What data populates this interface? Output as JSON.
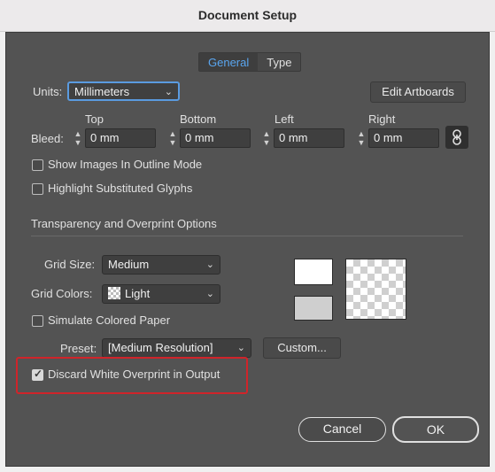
{
  "window": {
    "title": "Document Setup"
  },
  "tabs": [
    {
      "label": "General",
      "active": true
    },
    {
      "label": "Type",
      "active": false
    }
  ],
  "units": {
    "label": "Units:",
    "value": "Millimeters"
  },
  "edit_artboards": "Edit Artboards",
  "bleed": {
    "label": "Bleed:",
    "columns": [
      "Top",
      "Bottom",
      "Left",
      "Right"
    ],
    "values": [
      "0 mm",
      "0 mm",
      "0 mm",
      "0 mm"
    ],
    "link_icon": "chain-link-icon"
  },
  "options": {
    "show_images_outline": {
      "label": "Show Images In Outline Mode",
      "checked": false
    },
    "highlight_glyphs": {
      "label": "Highlight Substituted Glyphs",
      "checked": false
    }
  },
  "transparency": {
    "section_title": "Transparency and Overprint Options",
    "grid_size": {
      "label": "Grid Size:",
      "value": "Medium"
    },
    "grid_colors": {
      "label": "Grid Colors:",
      "value": "Light"
    },
    "simulate_paper": {
      "label": "Simulate Colored Paper",
      "checked": false
    },
    "preset": {
      "label": "Preset:",
      "value": "[Medium Resolution]"
    },
    "custom_button": "Custom...",
    "discard_white": {
      "label": "Discard White Overprint in Output",
      "checked": true
    }
  },
  "colors": {
    "highlight": "#d0242a",
    "accent": "#5aa6f0"
  },
  "footer": {
    "cancel": "Cancel",
    "ok": "OK"
  }
}
